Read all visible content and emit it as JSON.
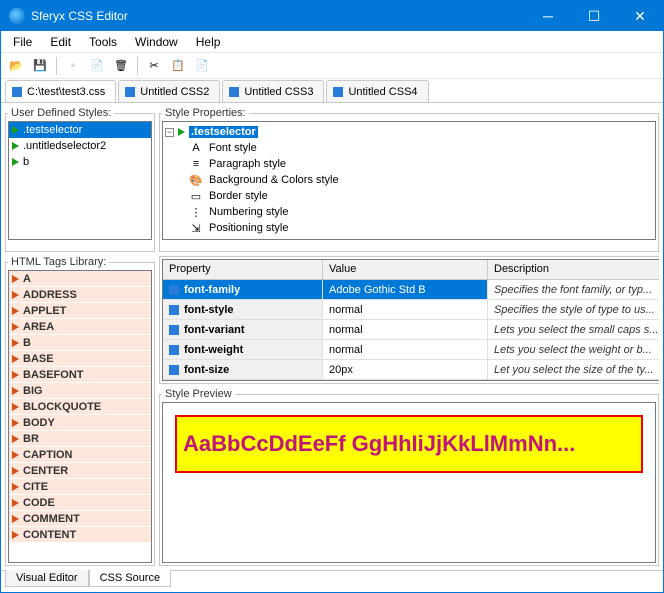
{
  "window": {
    "title": "Sferyx CSS Editor"
  },
  "menu": {
    "file": "File",
    "edit": "Edit",
    "tools": "Tools",
    "window": "Window",
    "help": "Help"
  },
  "tabs": [
    {
      "label": "C:\\test\\test3.css",
      "active": true
    },
    {
      "label": "Untitled CSS2",
      "active": false
    },
    {
      "label": "Untitled CSS3",
      "active": false
    },
    {
      "label": "Untitled CSS4",
      "active": false
    }
  ],
  "panels": {
    "userDefined": {
      "title": "User Defined Styles:",
      "items": [
        {
          "label": ".testselector",
          "selected": true
        },
        {
          "label": ".untitledselector2",
          "selected": false
        },
        {
          "label": "b",
          "selected": false
        }
      ]
    },
    "tagLibrary": {
      "title": "HTML Tags Library:",
      "items": [
        "A",
        "ADDRESS",
        "APPLET",
        "AREA",
        "B",
        "BASE",
        "BASEFONT",
        "BIG",
        "BLOCKQUOTE",
        "BODY",
        "BR",
        "CAPTION",
        "CENTER",
        "CITE",
        "CODE",
        "COMMENT",
        "CONTENT"
      ]
    },
    "styleProps": {
      "title": "Style Properties:",
      "root": ".testselector",
      "children": [
        {
          "label": "Font style",
          "icon": "A"
        },
        {
          "label": "Paragraph style",
          "icon": "≡"
        },
        {
          "label": "Background & Colors style",
          "icon": "🎨"
        },
        {
          "label": "Border style",
          "icon": "▭"
        },
        {
          "label": "Numbering style",
          "icon": "⋮"
        },
        {
          "label": "Positioning style",
          "icon": "⇲"
        }
      ]
    },
    "propGrid": {
      "headers": {
        "property": "Property",
        "value": "Value",
        "description": "Description"
      },
      "rows": [
        {
          "prop": "font-family",
          "value": "Adobe Gothic Std B",
          "desc": "Specifies the font family, or typ...",
          "selected": true
        },
        {
          "prop": "font-style",
          "value": "normal",
          "desc": "Specifies the style of type to us...",
          "selected": false
        },
        {
          "prop": "font-variant",
          "value": "normal",
          "desc": "Lets you select the small caps s...",
          "selected": false
        },
        {
          "prop": "font-weight",
          "value": "normal",
          "desc": "Lets you select the weight or b...",
          "selected": false
        },
        {
          "prop": "font-size",
          "value": "20px",
          "desc": "Let you select the size of the ty...",
          "selected": false
        }
      ]
    },
    "preview": {
      "title": "Style Preview",
      "text": "AaBbCcDdEeFf GgHhIiJjKkLlMmNn..."
    }
  },
  "bottomTabs": {
    "visual": "Visual Editor",
    "source": "CSS Source"
  }
}
